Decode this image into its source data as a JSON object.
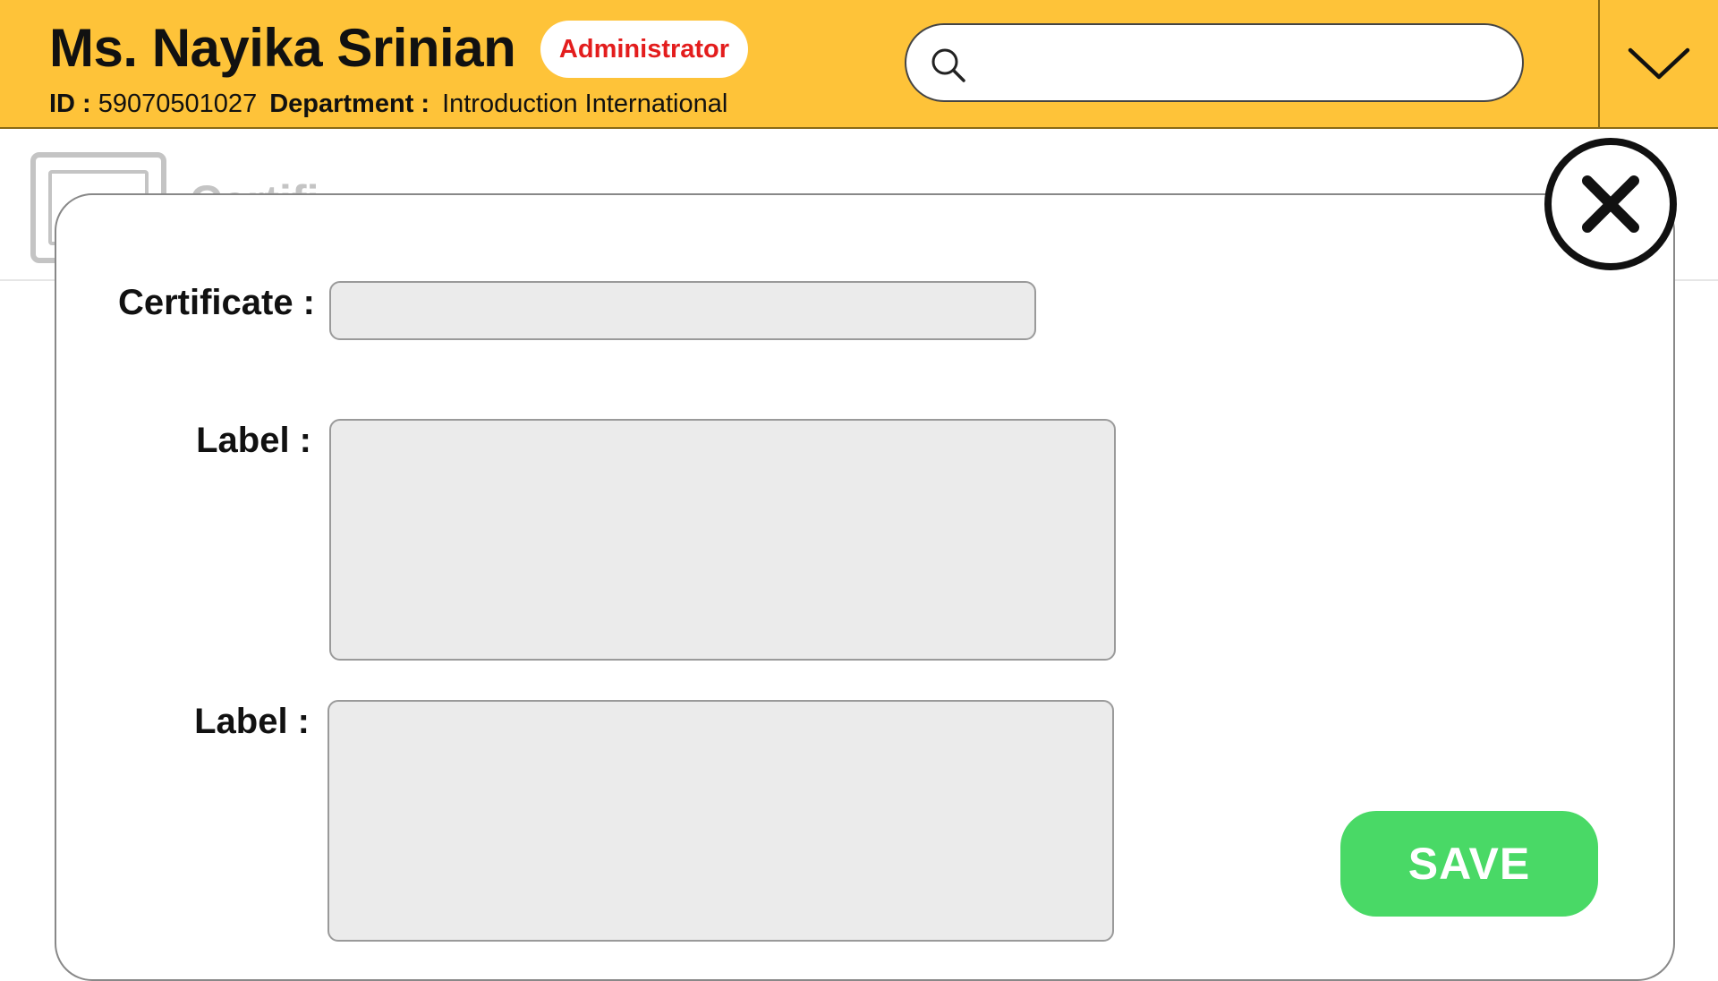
{
  "header": {
    "user_name": "Ms. Nayika Srinian",
    "role_badge": "Administrator",
    "id_label": "ID :",
    "id_value": "59070501027",
    "department_label": "Department :",
    "department_value": "Introduction International",
    "search": {
      "value": "",
      "placeholder": "",
      "icon": "search-icon"
    },
    "dropdown_icon": "chevron-down-icon"
  },
  "background_page": {
    "icon": "certificate-icon",
    "title": "Certifi"
  },
  "modal": {
    "close_icon": "close-icon",
    "fields": [
      {
        "label": "Certificate :",
        "value": ""
      },
      {
        "label": "Label :",
        "value": ""
      },
      {
        "label": "Label :",
        "value": ""
      }
    ],
    "save_label": "SAVE"
  },
  "colors": {
    "header_bg": "#FEC339",
    "role_text": "#E31D1D",
    "save_bg": "#49D966",
    "input_bg": "#EBEBEB"
  }
}
